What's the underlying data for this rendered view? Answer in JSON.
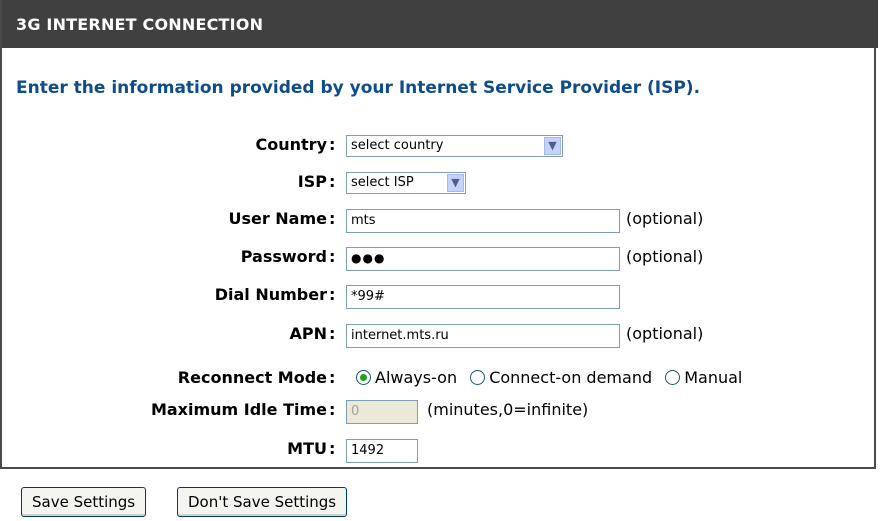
{
  "header": {
    "title": "3G INTERNET CONNECTION"
  },
  "intro": "Enter the information provided by your Internet Service Provider (ISP).",
  "fields": {
    "country": {
      "label": "Country",
      "value": "select country"
    },
    "isp": {
      "label": "ISP",
      "value": "select ISP"
    },
    "username": {
      "label": "User Name",
      "value": "mts",
      "hint": "(optional)"
    },
    "password": {
      "label": "Password",
      "value": "●●●",
      "hint": "(optional)"
    },
    "dial": {
      "label": "Dial Number",
      "value": "*99#"
    },
    "apn": {
      "label": "APN",
      "value": "internet.mts.ru",
      "hint": "(optional)"
    },
    "reconnect": {
      "label": "Reconnect Mode",
      "options": [
        "Always-on",
        "Connect-on demand",
        "Manual"
      ],
      "selected": "Always-on"
    },
    "idle": {
      "label": "Maximum Idle Time",
      "value": "0",
      "hint": "(minutes,0=infinite)"
    },
    "mtu": {
      "label": "MTU",
      "value": "1492"
    }
  },
  "colon": ":",
  "buttons": {
    "save": "Save Settings",
    "dont_save": "Don't Save Settings"
  },
  "colors": {
    "header_bg": "#404040",
    "intro_text": "#0f4c8a",
    "radio_checked": "#21a121"
  }
}
